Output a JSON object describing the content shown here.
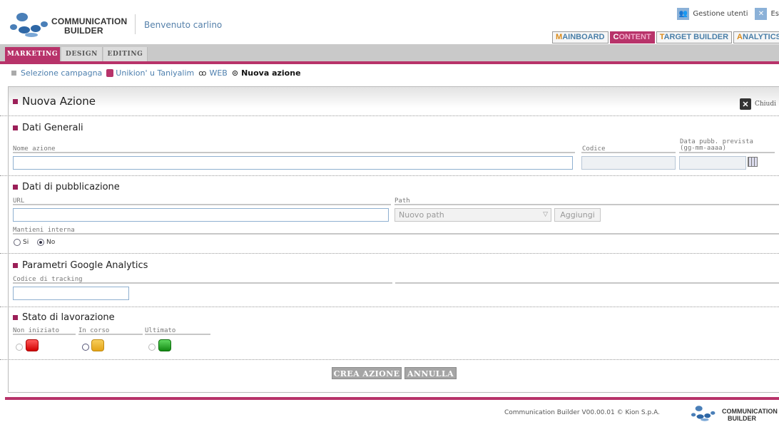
{
  "header": {
    "brand_line1": "COMMUNICATION",
    "brand_line2": "BUILDER",
    "welcome": "Benvenuto carlino",
    "utils": {
      "users": "Gestione utenti",
      "exit": "Es"
    },
    "product_tabs": [
      {
        "first": "M",
        "rest": "AINBOARD"
      },
      {
        "first": "C",
        "rest": "ONTENT"
      },
      {
        "first": "T",
        "rest": "ARGET BUILDER"
      },
      {
        "first": "A",
        "rest": "NALYTICS"
      }
    ],
    "active_product_tab": "CONTENT"
  },
  "section_tabs": [
    {
      "label": "MARKETING"
    },
    {
      "label": "DESIGN"
    },
    {
      "label": "EDITING"
    }
  ],
  "breadcrumb": {
    "items": [
      "Selezione campagna",
      "Unikion' u Taniyalim",
      "WEB",
      "Nuova azione"
    ]
  },
  "form": {
    "title": "Nuova Azione",
    "close_label": "Chiudi",
    "general": {
      "heading": "Dati Generali",
      "name_label": "Nome azione",
      "code_label": "Codice",
      "date_label_1": "Data pubb. prevista",
      "date_label_2": "(gg-mm-aaaa)",
      "name_value": "",
      "code_value": "",
      "date_value": ""
    },
    "publication": {
      "heading": "Dati di pubblicazione",
      "url_label": "URL",
      "path_label": "Path",
      "url_value": "",
      "path_selected": "Nuovo path",
      "add_label": "Aggiungi",
      "keep_label": "Mantieni interna",
      "radio_yes": "Si",
      "radio_no": "No",
      "keep_selected": "No"
    },
    "analytics": {
      "heading": "Parametri Google Analytics",
      "tracking_label": "Codice di tracking",
      "tracking_value": ""
    },
    "status": {
      "heading": "Stato di lavorazione",
      "options": [
        "Non iniziato",
        "In corso",
        "Ultimato"
      ],
      "selected": "In corso",
      "colors": {
        "not_started": "#e00000",
        "in_progress": "#f0b428",
        "done": "#20a020"
      }
    },
    "buttons": {
      "create": "CREA AZIONE",
      "cancel": "ANNULLA"
    }
  },
  "footer": {
    "text": "Communication Builder V00.00.01 © Kion S.p.A.",
    "brand_line1": "COMMUNICATION",
    "brand_line2": "BUILDER"
  },
  "colors": {
    "accent": "#b8336a",
    "link": "#4d7fae"
  },
  "icons": [
    "users-icon",
    "exit-icon",
    "calendar-icon",
    "close-icon",
    "campaign-icon",
    "web-icon",
    "target-icon"
  ]
}
